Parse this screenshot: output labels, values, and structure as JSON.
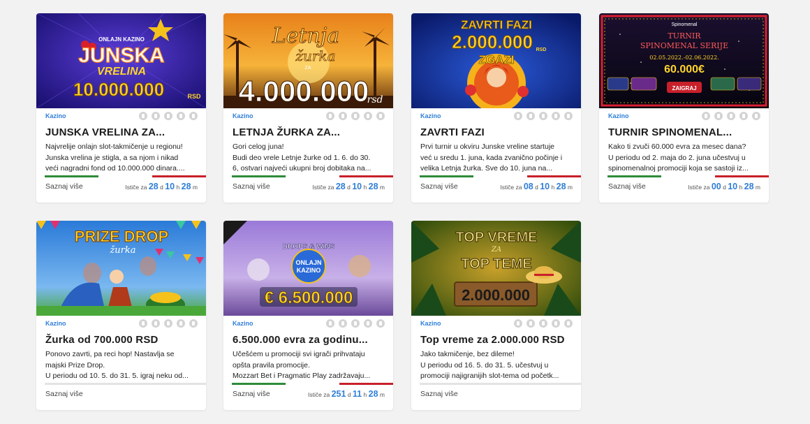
{
  "cards": [
    {
      "banner_lines": [
        "ONLAJN KAZINO",
        "JUNSKA",
        "VRELINA",
        "10.000.000",
        "RSD"
      ],
      "category": "Kazino",
      "title": "JUNSKA VRELINA ZA...",
      "desc1": "Najvrelije onlajn slot-takmičenje u regionu!",
      "desc2": "Junska vrelina je stigla, a sa njom i nikad",
      "desc3": "veći nagradni fond od 10.000.000 dinara....",
      "more": "Saznaj više",
      "timer": {
        "label": "Ističe za",
        "d": "28",
        "h": "10",
        "m": "28",
        "du": "d",
        "hu": "h",
        "mu": "m"
      }
    },
    {
      "banner_lines": [
        "Letnja",
        "žurka",
        "ZA",
        "4.000.000",
        "rsd"
      ],
      "category": "Kazino",
      "title": "LETNJA ŽURKA ZA...",
      "desc1": "Gori celog juna!",
      "desc2": "Budi deo vrele Letnje žurke od 1. 6. do 30.",
      "desc3": "6, ostvari najveći ukupni broj dobitaka na...",
      "more": "Saznaj više",
      "timer": {
        "label": "Ističe za",
        "d": "28",
        "h": "10",
        "m": "28",
        "du": "d",
        "hu": "h",
        "mu": "m"
      }
    },
    {
      "banner_lines": [
        "ZAVRTI FAZI",
        "2.000.000",
        "RSD",
        "ZGAZI"
      ],
      "category": "Kazino",
      "title": "ZAVRTI FAZI",
      "desc1": "Prvi turnir u okviru Junske vreline startuje",
      "desc2": "već u sredu 1. juna, kada zvanično počinje i",
      "desc3": "velika Letnja žurka. Sve do 10. juna na...",
      "more": "Saznaj više",
      "timer": {
        "label": "Ističe za",
        "d": "08",
        "h": "10",
        "m": "28",
        "du": "d",
        "hu": "h",
        "mu": "m"
      }
    },
    {
      "banner_lines": [
        "Spinomenal",
        "TURNIR",
        "SPINOMENAL SERIJE",
        "02.05.2022.-02.06.2022.",
        "60.000€",
        "ZAIGRAJ"
      ],
      "category": "Kazino",
      "title": "TURNIR SPINOMENAL...",
      "desc1": "Kako ti zvuči 60.000 evra za mesec dana?",
      "desc2": "U periodu od 2. maja do 2. juna učestvuj u",
      "desc3": "spinomenalnoj promociji koja se sastoji iz...",
      "more": "Saznaj više",
      "timer": {
        "label": "Ističe za",
        "d": "00",
        "h": "10",
        "m": "28",
        "du": "d",
        "hu": "h",
        "mu": "m"
      }
    },
    {
      "banner_lines": [
        "PRIZE DROP",
        "žurka"
      ],
      "category": "Kazino",
      "title": "Žurka od 700.000 RSD",
      "desc1": "Ponovo zavrti, pa reci hop! Nastavlja se",
      "desc2": "majski Prize Drop.",
      "desc3": "U periodu od 10. 5. do 31. 5. igraj neku od...",
      "more": "Saznaj više"
    },
    {
      "banner_lines": [
        "DROPS & WINS",
        "ONLAJN",
        "KAZINO",
        "€ 6.500.000"
      ],
      "category": "Kazino",
      "title": "6.500.000 evra za godinu...",
      "desc1": "Učešćem u promociji svi igrači prihvataju",
      "desc2": "opšta pravila promocije.",
      "desc3": "Mozzart Bet i Pragmatic Play zadržavaju...",
      "more": "Saznaj više",
      "timer": {
        "label": "Ističe za",
        "d": "251",
        "h": "11",
        "m": "28",
        "du": "d",
        "hu": "h",
        "mu": "m"
      }
    },
    {
      "banner_lines": [
        "TOP VREME",
        "ZA",
        "TOP TEME",
        "2.000.000"
      ],
      "category": "Kazino",
      "title": "Top vreme za 2.000.000 RSD",
      "desc1": "Jako takmičenje, bez dileme!",
      "desc2": "U periodu od 16. 5. do 31. 5. učestvuj u",
      "desc3": "promociji najigranijih slot-tema od početk...",
      "more": "Saznaj više"
    }
  ],
  "colors": {
    "accent": "#2f7fd8",
    "green": "#2e8b3a",
    "red": "#c8202a"
  },
  "icons": [
    "facebook-icon",
    "viber-icon",
    "whatsapp-icon",
    "twitter-icon",
    "link-icon"
  ]
}
